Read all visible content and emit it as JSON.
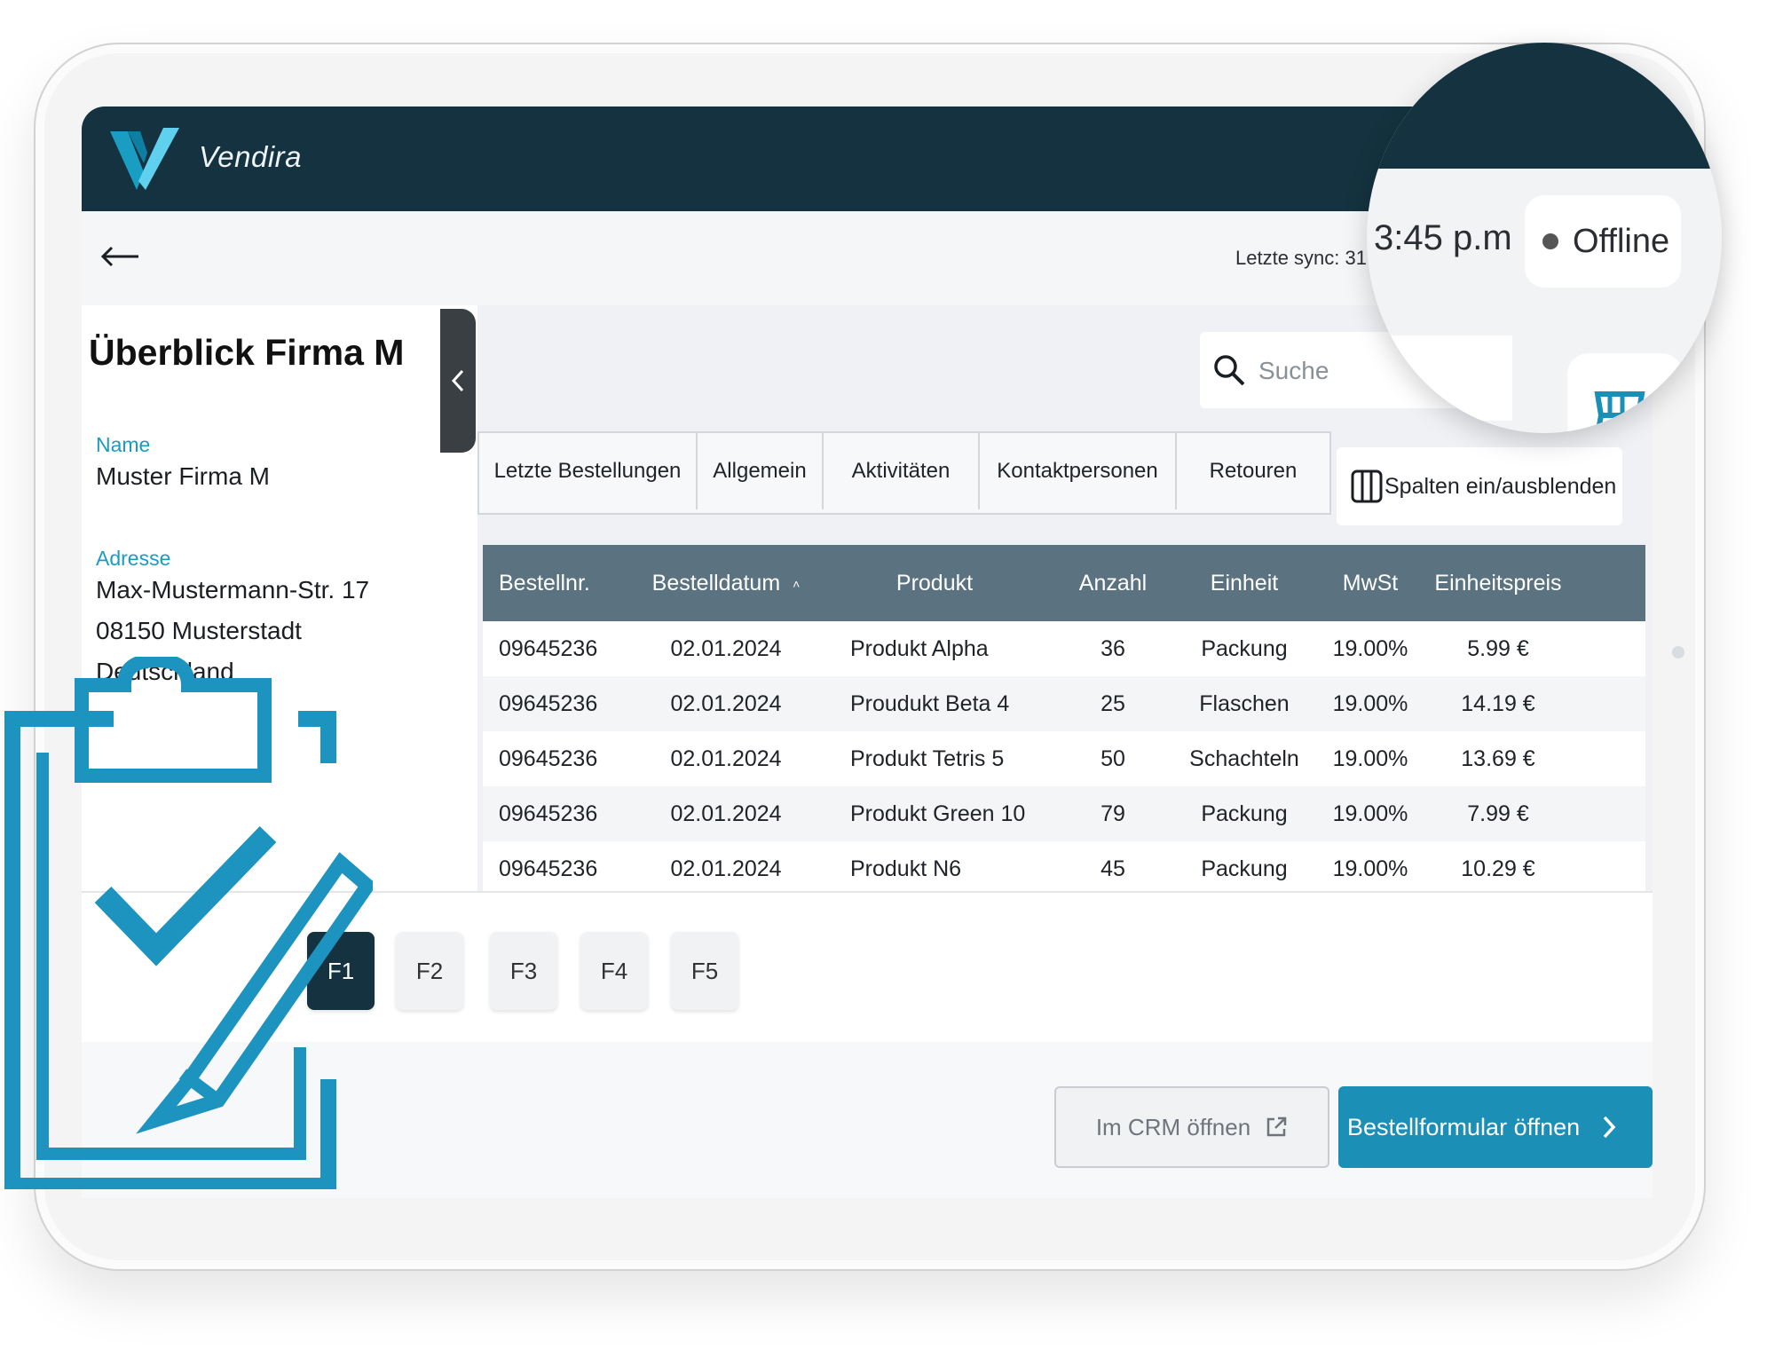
{
  "app": {
    "name": "Vendira"
  },
  "header": {
    "last_sync": "Letzte sync: 31.",
    "time": "3:45 p.m",
    "status": "Offline"
  },
  "overview": {
    "title": "Überblick Firma M",
    "name_label": "Name",
    "name_value": "Muster Firma M",
    "address_label": "Adresse",
    "address_lines": [
      "Max-Mustermann-Str. 17",
      "08150 Musterstadt",
      "Deutschland"
    ]
  },
  "search": {
    "placeholder": "Suche"
  },
  "tabs": [
    "Letzte Bestellungen",
    "Allgemein",
    "Aktivitäten",
    "Kontaktpersonen",
    "Retouren"
  ],
  "columns_button": "Spalten ein/ausblenden",
  "table": {
    "headers": [
      "Bestellnr.",
      "Bestelldatum",
      "Produkt",
      "Anzahl",
      "Einheit",
      "MwSt",
      "Einheitspreis"
    ],
    "rows": [
      [
        "09645236",
        "02.01.2024",
        "Produkt Alpha",
        "36",
        "Packung",
        "19.00%",
        "5.99 €"
      ],
      [
        "09645236",
        "02.01.2024",
        "Proudukt Beta 4",
        "25",
        "Flaschen",
        "19.00%",
        "14.19 €"
      ],
      [
        "09645236",
        "02.01.2024",
        "Produkt Tetris 5",
        "50",
        "Schachteln",
        "19.00%",
        "13.69 €"
      ],
      [
        "09645236",
        "02.01.2024",
        "Produkt Green 10",
        "79",
        "Packung",
        "19.00%",
        "7.99 €"
      ],
      [
        "09645236",
        "02.01.2024",
        "Produkt N6",
        "45",
        "Packung",
        "19.00%",
        "10.29 €"
      ]
    ]
  },
  "function_keys": [
    "F1",
    "F2",
    "F3",
    "F4",
    "F5"
  ],
  "actions": {
    "crm": "Im CRM öffnen",
    "order_form": "Bestellformular öffnen"
  },
  "colors": {
    "brand_dark": "#14323f",
    "accent": "#1b8fb5",
    "table_header": "#5b7380",
    "label": "#1b9bbf"
  },
  "icons": [
    "vendira-logo-icon",
    "back-arrow-icon",
    "chevron-left-icon",
    "search-icon",
    "columns-icon",
    "sort-icon",
    "external-link-icon",
    "chevron-right-icon",
    "clipboard-check-icon"
  ]
}
